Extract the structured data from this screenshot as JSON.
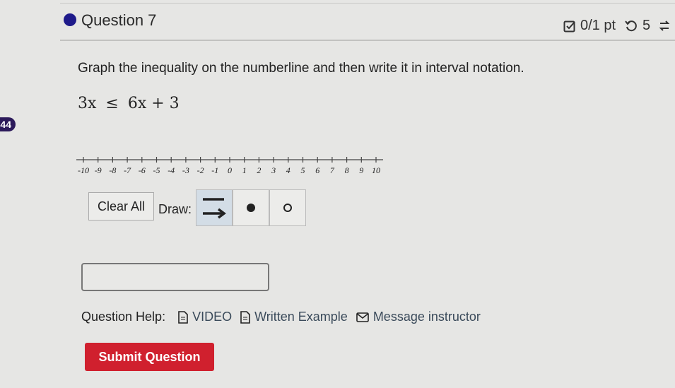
{
  "question": {
    "title": "Question 7",
    "score": "0/1 pt",
    "retries": "5",
    "badge": "44",
    "prompt": "Graph the inequality on the numberline and then write it in interval notation.",
    "inequality": {
      "left": "3x",
      "op": "≤",
      "right": "6x + 3"
    }
  },
  "numberline": {
    "min": -10,
    "max": 10,
    "labels": [
      "-10",
      "-9",
      "-8",
      "-7",
      "-6",
      "-5",
      "-4",
      "-3",
      "-2",
      "-1",
      "0",
      "1",
      "2",
      "3",
      "4",
      "5",
      "6",
      "7",
      "8",
      "9",
      "10"
    ]
  },
  "controls": {
    "clear_label": "Clear All",
    "draw_label": "Draw:",
    "tools": [
      {
        "name": "ray-tool",
        "icon": "line-arrow-icon",
        "active": true
      },
      {
        "name": "closed-dot-tool",
        "icon": "filled-dot-icon",
        "active": false
      },
      {
        "name": "open-dot-tool",
        "icon": "open-dot-icon",
        "active": false
      }
    ]
  },
  "answer": {
    "value": ""
  },
  "help": {
    "label": "Question Help:",
    "video": "VIDEO",
    "written_example": "Written Example",
    "message": "Message instructor"
  },
  "submit_label": "Submit Question",
  "colors": {
    "accent_dot": "#1e1a8a",
    "submit": "#d0202e",
    "badge": "#2c1a5a"
  }
}
